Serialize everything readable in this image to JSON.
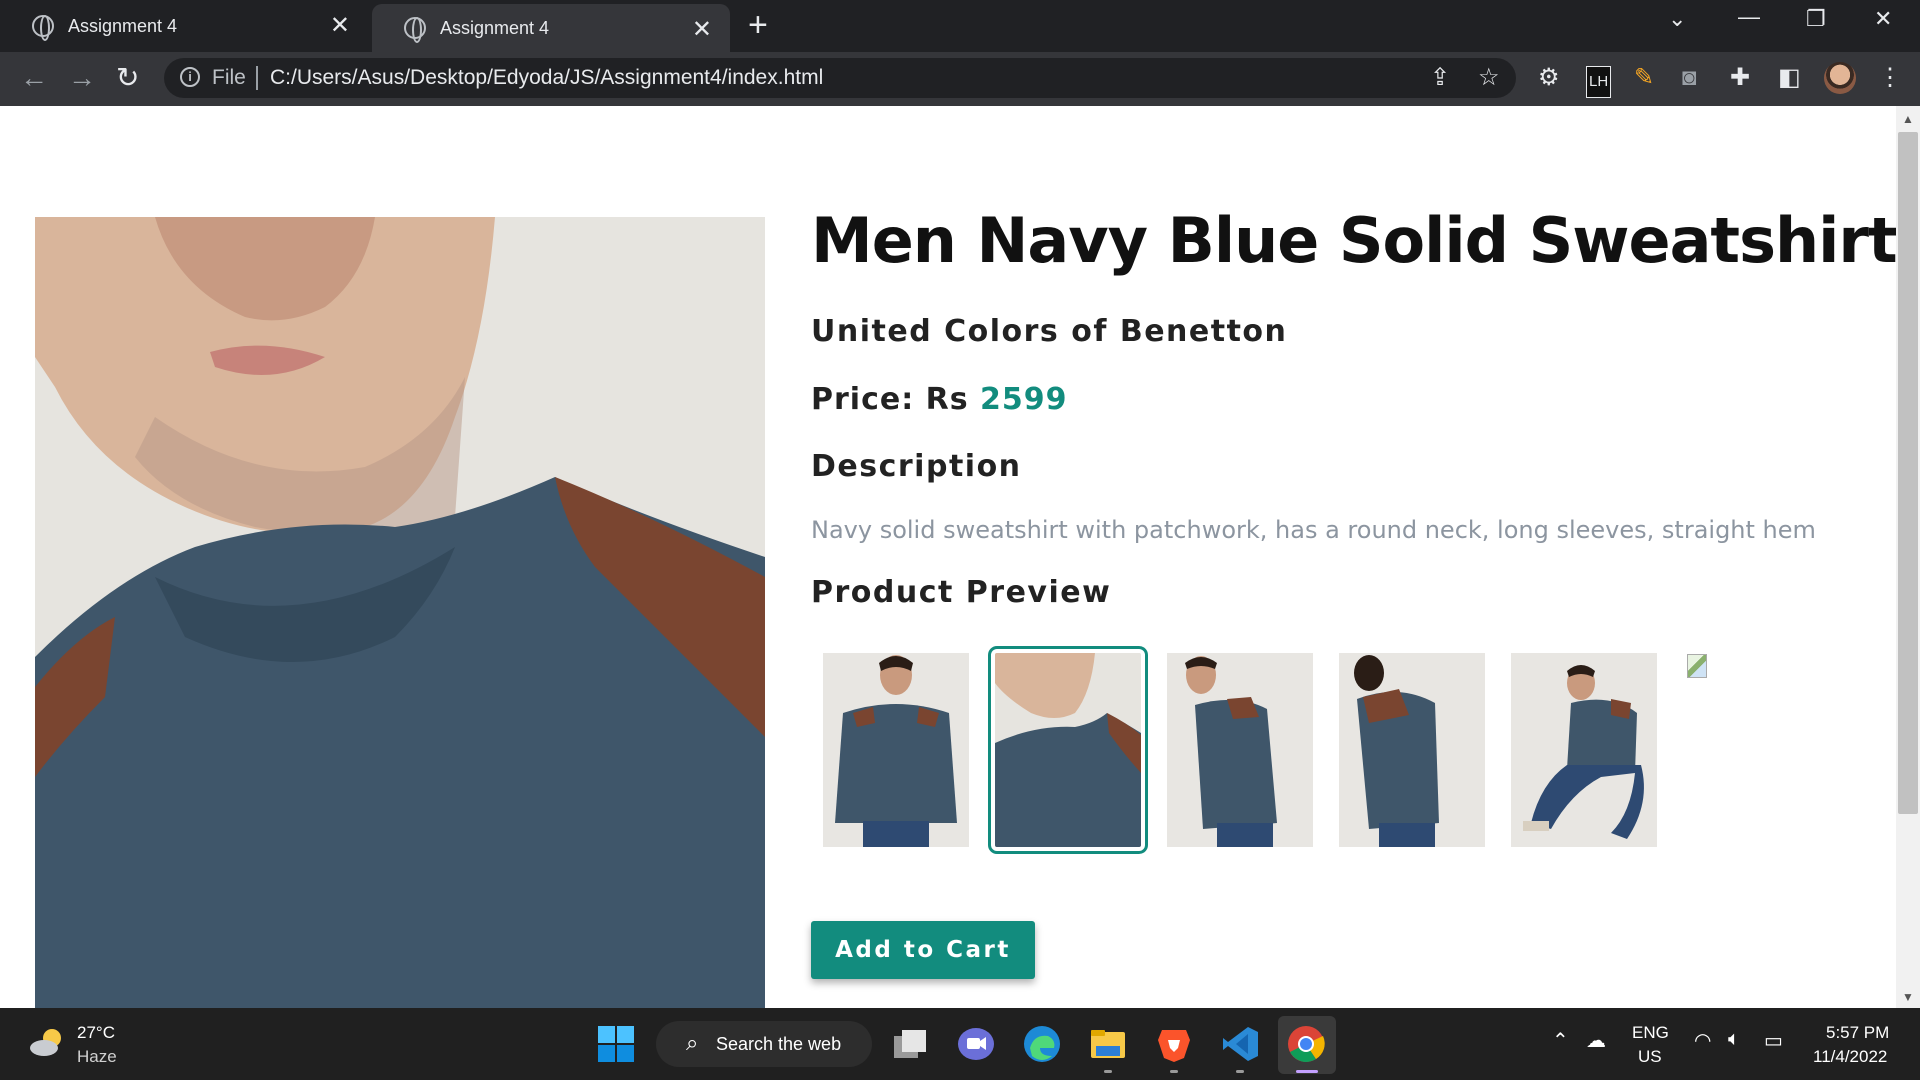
{
  "browser": {
    "tabs": [
      {
        "title": "Assignment 4"
      },
      {
        "title": "Assignment 4"
      }
    ],
    "address": {
      "scheme_label": "File",
      "url": "C:/Users/Asus/Desktop/Edyoda/JS/Assignment4/index.html"
    },
    "extension_lh_label": "LH"
  },
  "product": {
    "title": "Men Navy Blue Solid Sweatshirt",
    "brand": "United Colors of Benetton",
    "price_label": "Price: Rs ",
    "price_value": "2599",
    "description_heading": "Description",
    "description": "Navy solid sweatshirt with patchwork, has a round neck, long sleeves, straight hem",
    "preview_heading": "Product Preview",
    "selected_preview": 2,
    "add_to_cart_label": "Add to Cart",
    "accent_color": "#128c7e"
  },
  "taskbar": {
    "weather_temp": "27°C",
    "weather_desc": "Haze",
    "search_label": "Search the web",
    "lang_line1": "ENG",
    "lang_line2": "US",
    "time": "5:57 PM",
    "date": "11/4/2022"
  }
}
